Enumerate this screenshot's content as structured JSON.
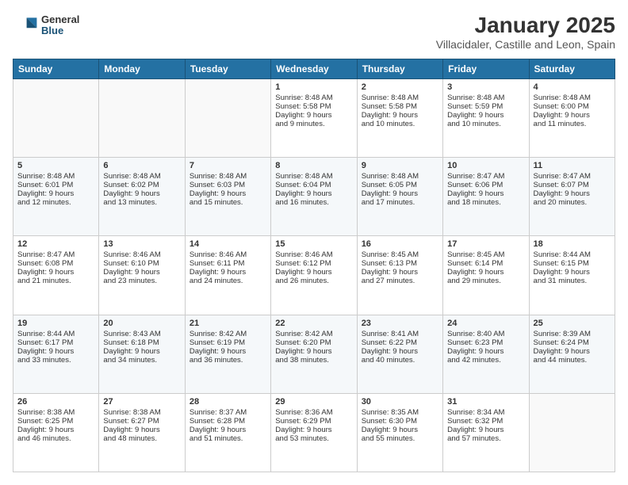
{
  "header": {
    "logo_general": "General",
    "logo_blue": "Blue",
    "main_title": "January 2025",
    "subtitle": "Villacidaler, Castille and Leon, Spain"
  },
  "days_of_week": [
    "Sunday",
    "Monday",
    "Tuesday",
    "Wednesday",
    "Thursday",
    "Friday",
    "Saturday"
  ],
  "weeks": [
    [
      {
        "day": "",
        "content": ""
      },
      {
        "day": "",
        "content": ""
      },
      {
        "day": "",
        "content": ""
      },
      {
        "day": "1",
        "content": "Sunrise: 8:48 AM\nSunset: 5:58 PM\nDaylight: 9 hours\nand 9 minutes."
      },
      {
        "day": "2",
        "content": "Sunrise: 8:48 AM\nSunset: 5:58 PM\nDaylight: 9 hours\nand 10 minutes."
      },
      {
        "day": "3",
        "content": "Sunrise: 8:48 AM\nSunset: 5:59 PM\nDaylight: 9 hours\nand 10 minutes."
      },
      {
        "day": "4",
        "content": "Sunrise: 8:48 AM\nSunset: 6:00 PM\nDaylight: 9 hours\nand 11 minutes."
      }
    ],
    [
      {
        "day": "5",
        "content": "Sunrise: 8:48 AM\nSunset: 6:01 PM\nDaylight: 9 hours\nand 12 minutes."
      },
      {
        "day": "6",
        "content": "Sunrise: 8:48 AM\nSunset: 6:02 PM\nDaylight: 9 hours\nand 13 minutes."
      },
      {
        "day": "7",
        "content": "Sunrise: 8:48 AM\nSunset: 6:03 PM\nDaylight: 9 hours\nand 15 minutes."
      },
      {
        "day": "8",
        "content": "Sunrise: 8:48 AM\nSunset: 6:04 PM\nDaylight: 9 hours\nand 16 minutes."
      },
      {
        "day": "9",
        "content": "Sunrise: 8:48 AM\nSunset: 6:05 PM\nDaylight: 9 hours\nand 17 minutes."
      },
      {
        "day": "10",
        "content": "Sunrise: 8:47 AM\nSunset: 6:06 PM\nDaylight: 9 hours\nand 18 minutes."
      },
      {
        "day": "11",
        "content": "Sunrise: 8:47 AM\nSunset: 6:07 PM\nDaylight: 9 hours\nand 20 minutes."
      }
    ],
    [
      {
        "day": "12",
        "content": "Sunrise: 8:47 AM\nSunset: 6:08 PM\nDaylight: 9 hours\nand 21 minutes."
      },
      {
        "day": "13",
        "content": "Sunrise: 8:46 AM\nSunset: 6:10 PM\nDaylight: 9 hours\nand 23 minutes."
      },
      {
        "day": "14",
        "content": "Sunrise: 8:46 AM\nSunset: 6:11 PM\nDaylight: 9 hours\nand 24 minutes."
      },
      {
        "day": "15",
        "content": "Sunrise: 8:46 AM\nSunset: 6:12 PM\nDaylight: 9 hours\nand 26 minutes."
      },
      {
        "day": "16",
        "content": "Sunrise: 8:45 AM\nSunset: 6:13 PM\nDaylight: 9 hours\nand 27 minutes."
      },
      {
        "day": "17",
        "content": "Sunrise: 8:45 AM\nSunset: 6:14 PM\nDaylight: 9 hours\nand 29 minutes."
      },
      {
        "day": "18",
        "content": "Sunrise: 8:44 AM\nSunset: 6:15 PM\nDaylight: 9 hours\nand 31 minutes."
      }
    ],
    [
      {
        "day": "19",
        "content": "Sunrise: 8:44 AM\nSunset: 6:17 PM\nDaylight: 9 hours\nand 33 minutes."
      },
      {
        "day": "20",
        "content": "Sunrise: 8:43 AM\nSunset: 6:18 PM\nDaylight: 9 hours\nand 34 minutes."
      },
      {
        "day": "21",
        "content": "Sunrise: 8:42 AM\nSunset: 6:19 PM\nDaylight: 9 hours\nand 36 minutes."
      },
      {
        "day": "22",
        "content": "Sunrise: 8:42 AM\nSunset: 6:20 PM\nDaylight: 9 hours\nand 38 minutes."
      },
      {
        "day": "23",
        "content": "Sunrise: 8:41 AM\nSunset: 6:22 PM\nDaylight: 9 hours\nand 40 minutes."
      },
      {
        "day": "24",
        "content": "Sunrise: 8:40 AM\nSunset: 6:23 PM\nDaylight: 9 hours\nand 42 minutes."
      },
      {
        "day": "25",
        "content": "Sunrise: 8:39 AM\nSunset: 6:24 PM\nDaylight: 9 hours\nand 44 minutes."
      }
    ],
    [
      {
        "day": "26",
        "content": "Sunrise: 8:38 AM\nSunset: 6:25 PM\nDaylight: 9 hours\nand 46 minutes."
      },
      {
        "day": "27",
        "content": "Sunrise: 8:38 AM\nSunset: 6:27 PM\nDaylight: 9 hours\nand 48 minutes."
      },
      {
        "day": "28",
        "content": "Sunrise: 8:37 AM\nSunset: 6:28 PM\nDaylight: 9 hours\nand 51 minutes."
      },
      {
        "day": "29",
        "content": "Sunrise: 8:36 AM\nSunset: 6:29 PM\nDaylight: 9 hours\nand 53 minutes."
      },
      {
        "day": "30",
        "content": "Sunrise: 8:35 AM\nSunset: 6:30 PM\nDaylight: 9 hours\nand 55 minutes."
      },
      {
        "day": "31",
        "content": "Sunrise: 8:34 AM\nSunset: 6:32 PM\nDaylight: 9 hours\nand 57 minutes."
      },
      {
        "day": "",
        "content": ""
      }
    ]
  ]
}
